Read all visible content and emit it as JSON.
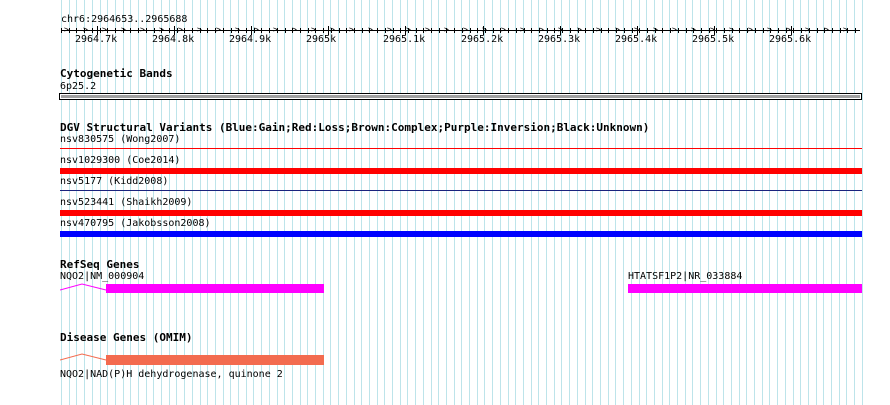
{
  "ruler": {
    "region": "chr6:2964653..2965688",
    "ticks": [
      "2964.7k",
      "2964.8k",
      "2964.9k",
      "2965k",
      "2965.1k",
      "2965.2k",
      "2965.3k",
      "2965.4k",
      "2965.5k",
      "2965.6k"
    ]
  },
  "cytoband": {
    "title": "Cytogenetic Bands",
    "band_label": "6p25.2",
    "band_color": "#a0a0a0"
  },
  "dgv": {
    "title": "DGV Structural Variants (Blue:Gain;Red:Loss;Brown:Complex;Purple:Inversion;Black:Unknown)",
    "variants": [
      {
        "label": "nsv830575 (Wong2007)",
        "color": "#ff0000",
        "style": "thin"
      },
      {
        "label": "nsv1029300 (Coe2014)",
        "color": "#ff0000",
        "style": "thick"
      },
      {
        "label": "nsv5177 (Kidd2008)",
        "color": "#1a237e",
        "style": "thin"
      },
      {
        "label": "nsv523441 (Shaikh2009)",
        "color": "#ff0000",
        "style": "thick"
      },
      {
        "label": "nsv470795 (Jakobsson2008)",
        "color": "#0000ff",
        "style": "thick"
      }
    ]
  },
  "refseq": {
    "title": "RefSeq Genes",
    "genes": [
      {
        "label": "NQO2|NM_000904",
        "color": "#ff00ff"
      },
      {
        "label": "HTATSF1P2|NR_033884",
        "color": "#ff00ff"
      }
    ]
  },
  "omim": {
    "title": "Disease Genes (OMIM)",
    "genes": [
      {
        "label": "NQO2|NAD(P)H dehydrogenase, quinone 2",
        "color": "#f36b4f"
      }
    ]
  }
}
